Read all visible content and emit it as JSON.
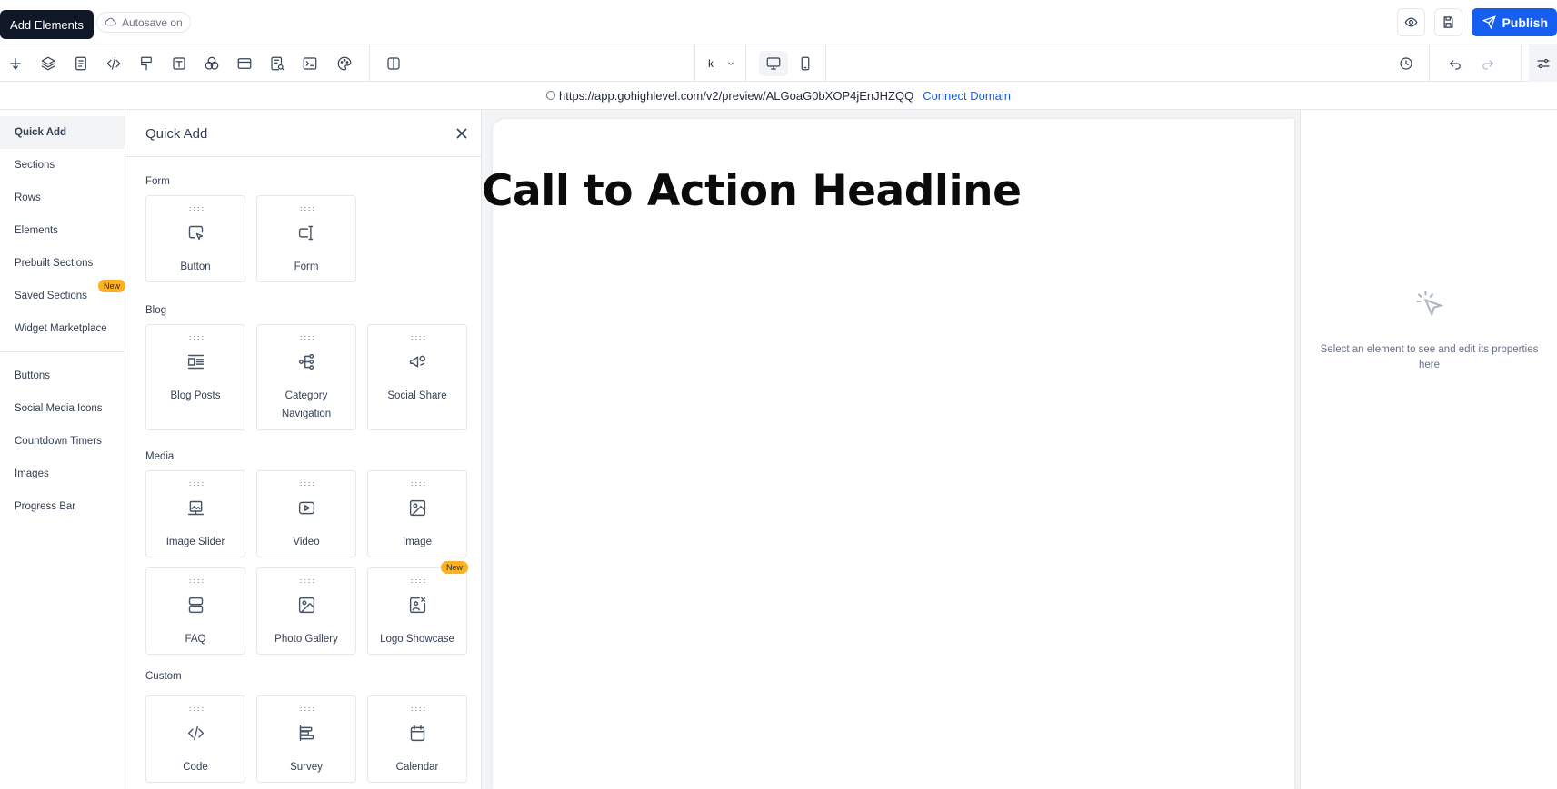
{
  "topbar": {
    "tooltip": "Add Elements",
    "autosave": "Autosave on",
    "publish_label": "Publish"
  },
  "toolbar": {
    "tools": [
      "plus-icon",
      "layers-icon",
      "page-icon",
      "code-icon",
      "paint-roller-icon",
      "text-icon",
      "circles-icon",
      "browser-icon",
      "search-doc-icon",
      "terminal-icon",
      "palette-icon",
      "split-view-icon"
    ],
    "device_select_value": "k"
  },
  "url": {
    "address": "https://app.gohighlevel.com/v2/preview/ALGoaG0bXOP4jEnJHZQQ",
    "connect_label": "Connect Domain"
  },
  "leftnav": {
    "items": [
      "Quick Add",
      "Sections",
      "Rows",
      "Elements",
      "Prebuilt Sections",
      "Saved Sections",
      "Widget Marketplace"
    ],
    "new_badge": "New",
    "items2": [
      "Buttons",
      "Social Media Icons",
      "Countdown Timers",
      "Images",
      "Progress Bar"
    ]
  },
  "panel": {
    "title": "Quick Add",
    "groups": {
      "form": {
        "title": "Form",
        "items": [
          "Button",
          "Form"
        ]
      },
      "blog": {
        "title": "Blog",
        "items": [
          "Blog Posts",
          "Category Navigation",
          "Social Share"
        ]
      },
      "media": {
        "title": "Media",
        "items": [
          "Image Slider",
          "Video",
          "Image",
          "FAQ",
          "Photo Gallery",
          "Logo Showcase"
        ]
      },
      "custom": {
        "title": "Custom",
        "items": [
          "Code",
          "Survey",
          "Calendar"
        ]
      }
    },
    "new_badge": "New"
  },
  "canvas": {
    "headline": "Call to Action Headline"
  },
  "rightpanel": {
    "hint": "Select an element to see and edit its properties here"
  },
  "colors": {
    "accent": "#155eef",
    "badge": "#fdb022"
  }
}
